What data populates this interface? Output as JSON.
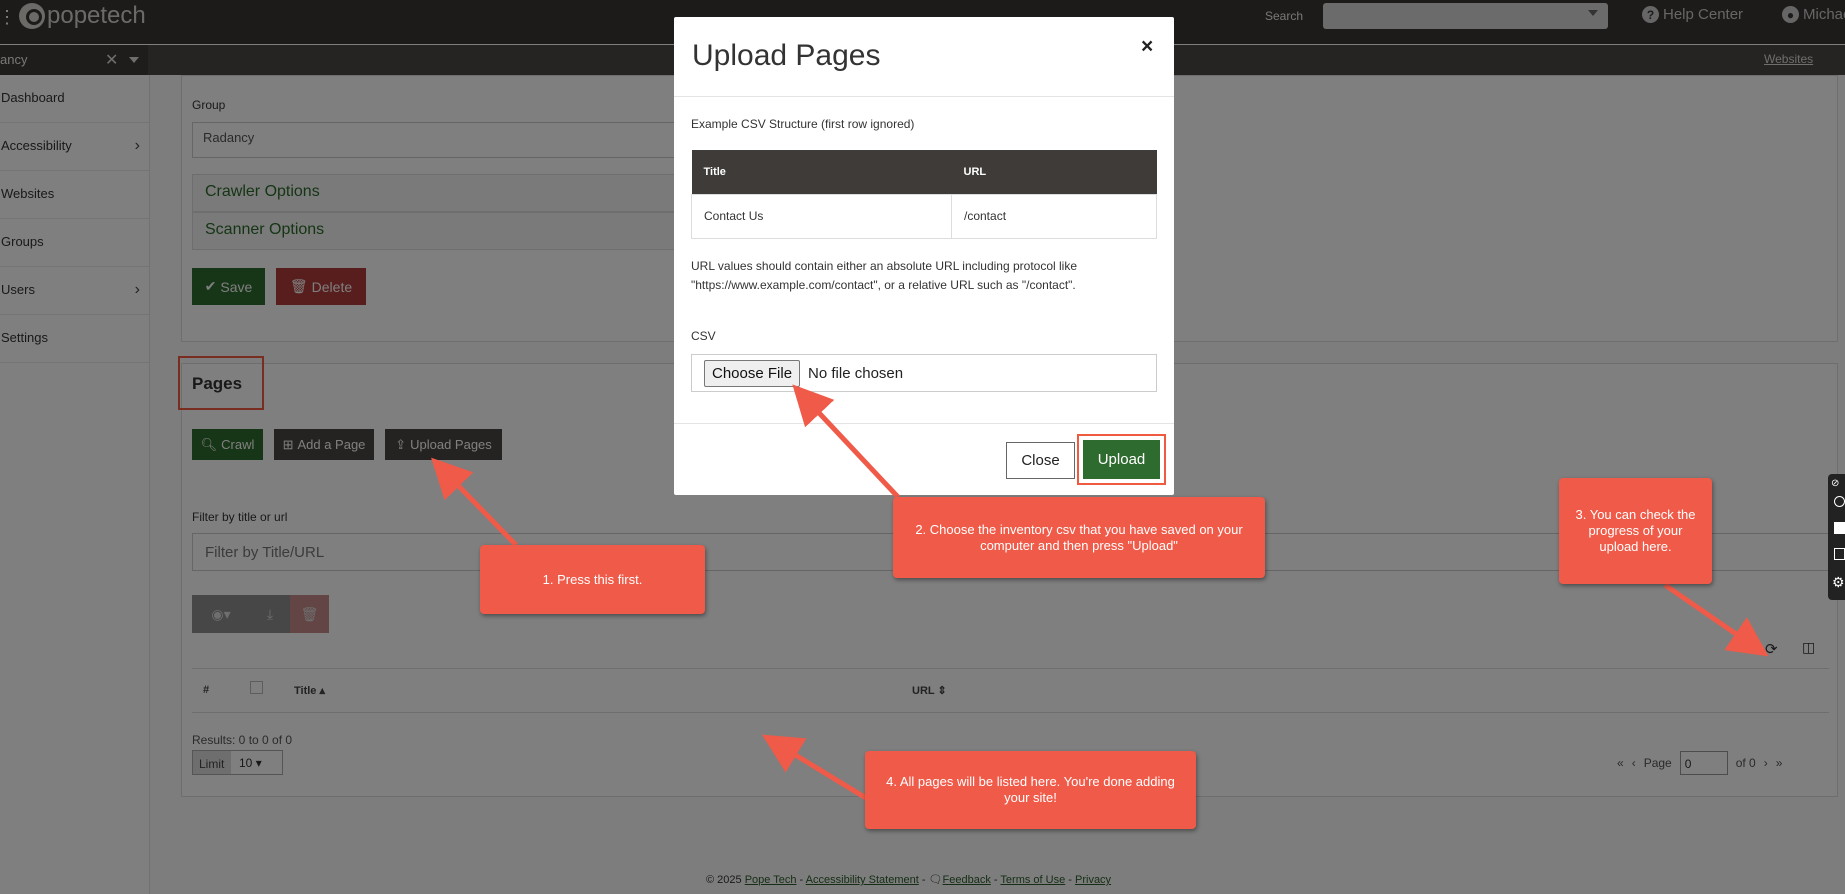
{
  "topbar": {
    "logo_text": "popetech",
    "search_label": "Search",
    "search_value": "",
    "help_label": "Help Center",
    "user_label": "Michae",
    "menu_icon": "menu-icon",
    "help_icon": "question-circle-icon",
    "user_icon": "user-circle-icon"
  },
  "subbar": {
    "org_value": "ancy",
    "breadcrumb_right": "Websites"
  },
  "sidebar": {
    "items": [
      {
        "label": "Dashboard",
        "has_submenu": false
      },
      {
        "label": "Accessibility",
        "has_submenu": true
      },
      {
        "label": "Websites",
        "has_submenu": false
      },
      {
        "label": "Groups",
        "has_submenu": false
      },
      {
        "label": "Users",
        "has_submenu": true
      },
      {
        "label": "Settings",
        "has_submenu": false
      }
    ]
  },
  "settings_card": {
    "group_label": "Group",
    "group_value": "Radancy",
    "crawler_options": "Crawler Options",
    "scanner_options": "Scanner Options",
    "save_label": "Save",
    "delete_label": "Delete"
  },
  "pages_card": {
    "title": "Pages",
    "crawl_label": "Crawl",
    "add_page_label": "Add a Page",
    "upload_pages_label": "Upload Pages",
    "filter_label": "Filter by title or url",
    "filter_placeholder": "Filter by Title/URL",
    "columns": [
      "#",
      "Title",
      "URL"
    ],
    "results_text": "Results: 0 to 0 of 0",
    "limit_label": "Limit",
    "limit_value": "10",
    "page_label": "Page",
    "page_value": "0",
    "page_of": "of 0"
  },
  "modal": {
    "title": "Upload Pages",
    "close_symbol": "×",
    "example_title": "Example CSV Structure (first row ignored)",
    "table_headers": [
      "Title",
      "URL"
    ],
    "table_rows": [
      [
        "Contact Us",
        "/contact"
      ]
    ],
    "note": "URL values should contain either an absolute URL including protocol like \"https://www.example.com/contact\", or a relative URL such as \"/contact\".",
    "csv_label": "CSV",
    "choose_file_label": "Choose File",
    "no_file_label": "No file chosen",
    "close_label": "Close",
    "upload_label": "Upload"
  },
  "callouts": {
    "step1": "1. Press this first.",
    "step2": "2. Choose the inventory csv that you have saved on your computer and then press \"Upload\"",
    "step3": "3. You can check the progress of your upload here.",
    "step4": "4. All pages will be listed here. You're done adding your site!"
  },
  "footer": {
    "copyright": "© 2025",
    "pope_tech": "Pope Tech",
    "accessibility_statement": "Accessibility Statement",
    "feedback": "Feedback",
    "terms": "Terms of Use",
    "privacy": "Privacy",
    "separator": " - "
  },
  "colors": {
    "accent_green": "#2e6b2e",
    "danger_red": "#b13a3a",
    "callout": "#f05a48",
    "topbar": "#3a3634"
  }
}
